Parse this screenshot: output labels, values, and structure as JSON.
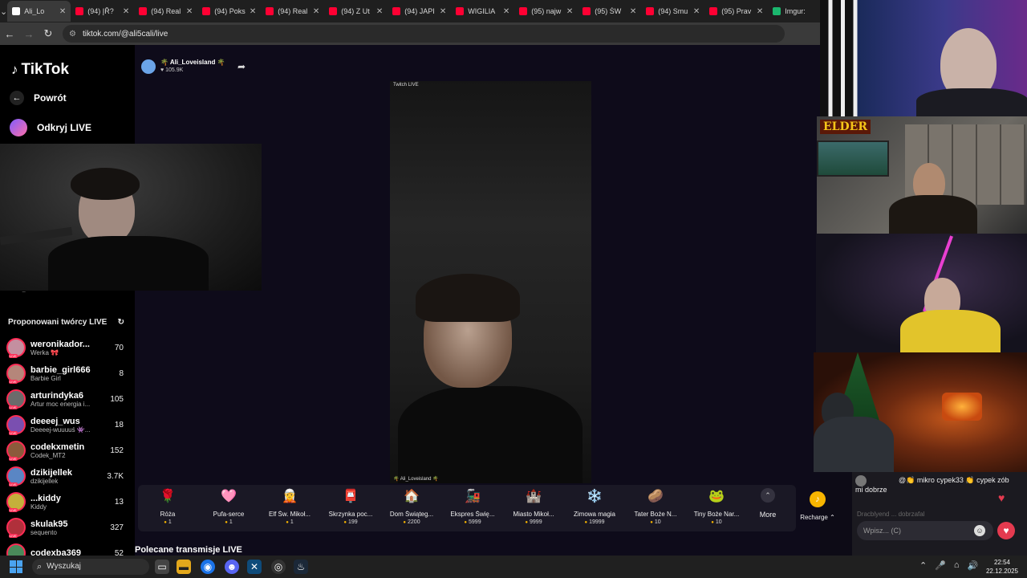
{
  "browser": {
    "tabs": [
      {
        "title": "Ali_Lo",
        "icon_color": "#ffffff",
        "active": true
      },
      {
        "title": "(94) ĮŘ?",
        "icon_color": "#ff0033",
        "active": false
      },
      {
        "title": "(94) Real",
        "icon_color": "#ff0033",
        "active": false
      },
      {
        "title": "(94) Poks",
        "icon_color": "#ff0033",
        "active": false
      },
      {
        "title": "(94) Real",
        "icon_color": "#ff0033",
        "active": false
      },
      {
        "title": "(94) Z Ut",
        "icon_color": "#ff0033",
        "active": false
      },
      {
        "title": "(94) JAPI",
        "icon_color": "#ff0033",
        "active": false
      },
      {
        "title": "WIGILIA",
        "icon_color": "#ff0033",
        "active": false
      },
      {
        "title": "(95) najw",
        "icon_color": "#ff0033",
        "active": false
      },
      {
        "title": "(95) ŚW",
        "icon_color": "#ff0033",
        "active": false
      },
      {
        "title": "(94) Smu",
        "icon_color": "#ff0033",
        "active": false
      },
      {
        "title": "(95) Prav",
        "icon_color": "#ff0033",
        "active": false
      },
      {
        "title": "Imgur:",
        "icon_color": "#1bb76e",
        "active": false
      }
    ],
    "url": "tiktok.com/@ali5cali/live"
  },
  "sidebar": {
    "logo": "TikTok",
    "back_label": "Powrót",
    "discover_label": "Odkryj LIVE",
    "hidden_item": "Ali_Loveisland",
    "suggested_header": "Proponowani twórcy LIVE",
    "creators": [
      {
        "name": "weronikador...",
        "sub": "Werka 🎀",
        "count": "70",
        "color": "#c48fa0"
      },
      {
        "name": "barbie_girl666",
        "sub": "Barbie Girl",
        "count": "8",
        "color": "#b5867a"
      },
      {
        "name": "arturindyka6",
        "sub": "Artur moc energia i...",
        "count": "105",
        "color": "#6b6b6b"
      },
      {
        "name": "deeeej_wus",
        "sub": "Deeeej-wuuuuś 👾...",
        "count": "18",
        "color": "#7a4fb0"
      },
      {
        "name": "codekxmetin",
        "sub": "Codek_MT2",
        "count": "152",
        "color": "#8b5a3b"
      },
      {
        "name": "dzikijellek",
        "sub": "dzikijellek",
        "count": "3.7K",
        "color": "#5a86c4"
      },
      {
        "name": "...kiddy",
        "sub": "Kiddy",
        "count": "13",
        "color": "#c4b03b"
      },
      {
        "name": "skulak95",
        "sub": "sequento",
        "count": "327",
        "color": "#b0303b"
      },
      {
        "name": "codexba369",
        "sub": "",
        "count": "52",
        "color": "#4a8a5a"
      }
    ]
  },
  "stream": {
    "streamer": "🌴 Ali_Loveisland 🌴",
    "likes": "105.9K",
    "video_tag": "Twitch LIVE",
    "video_watermark": "🌴 Ali_Loveisland 🌴"
  },
  "overlay": {
    "elder_label": "ELDER"
  },
  "gifts": [
    {
      "name": "Róża",
      "price": "1",
      "icon": "🌹"
    },
    {
      "name": "Pufa-serce",
      "price": "1",
      "icon": "🩷"
    },
    {
      "name": "Elf Św. Mikoł...",
      "price": "1",
      "icon": "🧝"
    },
    {
      "name": "Skrzynka poc...",
      "price": "199",
      "icon": "📮"
    },
    {
      "name": "Dom Świąteg...",
      "price": "2200",
      "icon": "🏠"
    },
    {
      "name": "Ekspres Świę...",
      "price": "5999",
      "icon": "🚂"
    },
    {
      "name": "Miasto Mikoł...",
      "price": "9999",
      "icon": "🏰"
    },
    {
      "name": "Zimowa magia",
      "price": "19999",
      "icon": "❄️"
    },
    {
      "name": "Tater Boże N...",
      "price": "10",
      "icon": "🥔"
    },
    {
      "name": "Tiny Boże Nar...",
      "price": "10",
      "icon": "🐸"
    }
  ],
  "gift_controls": {
    "more_label": "More",
    "recharge_label": "Recharge ⌃"
  },
  "recommended_heading": "Polecane transmisje LIVE",
  "chat": {
    "message_user": "@👏 mikro",
    "message_text": "cypek33 👏 cypek zób mi dobrze",
    "faded_text": "Dracblyend ... dobrzafal",
    "input_placeholder": "Wpisz... (C)"
  },
  "taskbar": {
    "search_label": "Wyszukaj",
    "time": "22:54",
    "date": "22.12.2025"
  }
}
